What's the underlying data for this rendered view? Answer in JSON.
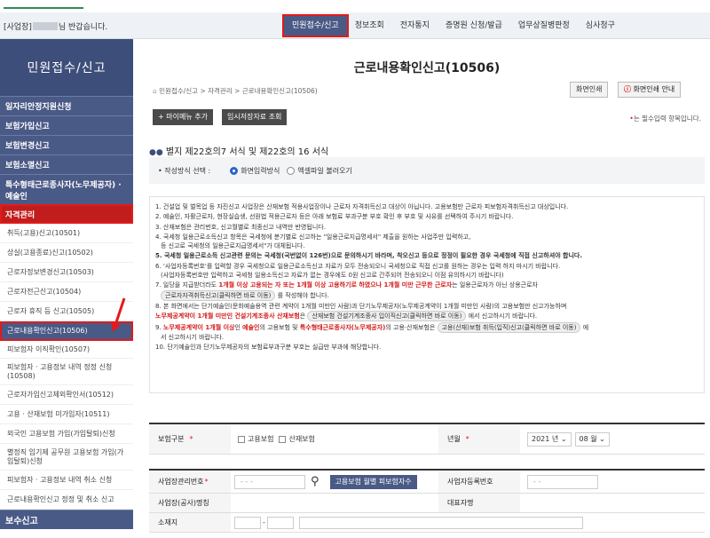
{
  "header": {
    "welcome_prefix": "[사업장]",
    "welcome_suffix": "님 반갑습니다.",
    "nav": [
      "민원접수/신고",
      "정보조회",
      "전자통지",
      "증명원 신청/발급",
      "업무상질병판정",
      "심사청구"
    ],
    "active_nav": 0
  },
  "sidebar": {
    "title": "민원접수/신고",
    "categories": [
      {
        "label": "일자리안정지원신청",
        "active": false
      },
      {
        "label": "보험가입신고",
        "active": false
      },
      {
        "label": "보험변경신고",
        "active": false
      },
      {
        "label": "보험소멸신고",
        "active": false
      },
      {
        "label": "특수형태근로종사자(노무제공자) · 예술인",
        "active": false
      },
      {
        "label": "자격관리",
        "active": true
      }
    ],
    "sub_items": [
      {
        "label": "취득(고용)신고(10501)",
        "active": false
      },
      {
        "label": "상실(고용종료)신고(10502)",
        "active": false
      },
      {
        "label": "근로자정보변경신고(10503)",
        "active": false
      },
      {
        "label": "근로자전근신고(10504)",
        "active": false
      },
      {
        "label": "근로자 휴직 등 신고(10505)",
        "active": false
      },
      {
        "label": "근로내용확인신고(10506)",
        "active": true
      },
      {
        "label": "피보험자 이직확인(10507)",
        "active": false
      },
      {
        "label": "피보험자 · 고용정보 내역 정정 신청(10508)",
        "active": false
      },
      {
        "label": "근로자가입신고제외확인서(10512)",
        "active": false
      },
      {
        "label": "고용 · 산재보험 미가입자(10511)",
        "active": false
      },
      {
        "label": "외국인 고용보험 가입(가입탈퇴)신청",
        "active": false
      },
      {
        "label": "별정직 임기제 공무원 고용보험 가입(가입탈퇴)신청",
        "active": false
      },
      {
        "label": "피보험자 · 고용정보 내역 취소 신청",
        "active": false
      },
      {
        "label": "근로내용확인신고 정정 및 취소 신고",
        "active": false
      }
    ],
    "bottom_category": "보수신고"
  },
  "main": {
    "title": "근로내용확인신고(10506)",
    "breadcrumb": "민원접수/신고 > 자격관리 > 근로내용확인신고(10506)",
    "print_button": "화면인쇄",
    "print_guide_button": "화면인쇄 안내",
    "add_menu_button": "+ 마이메뉴 추가",
    "temp_save_button": "임시저장자료 조회",
    "required_note_star": "•",
    "required_note": "는 필수입력 항목입니다.",
    "section_title": "별지 제22호의7 서식 및 제22호의 16 서식",
    "method_label": "• 작성방식 선택 :",
    "method_options": [
      "화면입력방식",
      "엑셀파일 불러오기"
    ],
    "notices": {
      "n1": "1. 건설업 및 벌목업 등 자진신고 사업장은 산재보험 적용사업장이나 근로자 자격취득신고 대상이 아닙니다. 고용보험만 근로자 피보험자격취득신고 대상입니다.",
      "n2": "2. 예술인, 자활근로자, 현장실습생, 선원법 적용근로자 등은 아래 보험료 부과구분 부호 확인 후 부호 및 사유를 선택하여 주시기 바랍니다.",
      "n3": "3. 산재보험은 관리번호, 신고월별로 최종신고 내역만 반영됩니다.",
      "n4a": "4. 국세청 일용근로소득신고 항목은 국세청에 분기별로 신고하는 \"일용근로지급명세서\" 제출을 원하는 사업주만 입력하고,",
      "n4b": "등 신고로 국세청의 일용근로지급명세서\"가 대체됩니다.",
      "n5": "5. 국세청 일용근로소득 신고관련 문의는 국세청(국번없이 126번)으로 문의하시기 바라며, 착오신고 등으로 정정이 필요한 경우 국세청에 직접 신고하셔야 합니다.",
      "n6a": "6. '사업자등록번호'를 입력할 경우 국세청으로 일용근로소득신고 자료가 모두 전송되오니 국세청으로 직접 신고를 원하는 경우는 입력 하지 마시기 바랍니다.",
      "n6b": "(사업자등록번호만 입력하고 국세청 일용소득신고 자료가 없는 경우에도 0원 신고로 간주되어 전송되오니 이점 유의하시기 바랍니다)",
      "n7a_pre": "7. 일당을 지급받더라도 ",
      "n7a_red1": "1개월 이상 고용되는 자 또는 1개월 이상 고용하기로 하였으나 1개월 미만 근무한 근로자",
      "n7a_post": "는 일용근로자가 아닌 상용근로자",
      "n7b_pill": "근로자자격취득신고(클릭하면 바로 이동)",
      "n7b_post": "를 작성해야 합니다.",
      "n8a": "8. 본 화면에서는 단기예술인(문화예술용역 관련 계약이 1개월 미만인 사람)과 단기노무제공자(노무제공계약이 1개월 미만인 사람)의 고용보험만 신고가능하며",
      "n8b_red": "노무제공계약이 1개월 미만인 건설기계조종사 산재보험",
      "n8b_mid": "은",
      "n8b_pill": "산재보험 건설기계조종사 입이직신고(클릭하면 바로 이동)",
      "n8b_post": "에서 신고하시기 바랍니다.",
      "n9a_pre": "9. ",
      "n9a_red1": "노무제공계약이 1개월 이상",
      "n9a_mid1": "인 ",
      "n9a_red2": "예술인",
      "n9a_mid2": "의 고용보험 및 ",
      "n9a_red3": "특수형태근로종사자(노무제공자)",
      "n9a_mid3": "의 고용·산재보험은",
      "n9a_pill": "고용(산재)보험 취득(입직)신고(클릭하면 바로 이동)",
      "n9a_post": "에",
      "n9b": "서 신고하시기 바랍니다.",
      "n10": "10. 단기예술인과 단기노무제공자의 보험료부과구분 부호는 실급만 부과에 해당합니다."
    },
    "form": {
      "insurance_label": "보험구분",
      "insurance_options": [
        "고용보험",
        "산재보험"
      ],
      "yearmonth_label": "년월",
      "year_value": "2021 년",
      "month_value": "08 월",
      "mgmt_no_label": "사업장관리번호",
      "mgmt_no_placeholder": "-  -  -",
      "monthly_button": "고용보험 월별 피보험자수",
      "biz_reg_label": "사업자등록번호",
      "biz_reg_placeholder": "-  -",
      "workplace_name_label": "사업장(공사)명칭",
      "ceo_label": "대표자명",
      "address_label": "소재지"
    }
  }
}
